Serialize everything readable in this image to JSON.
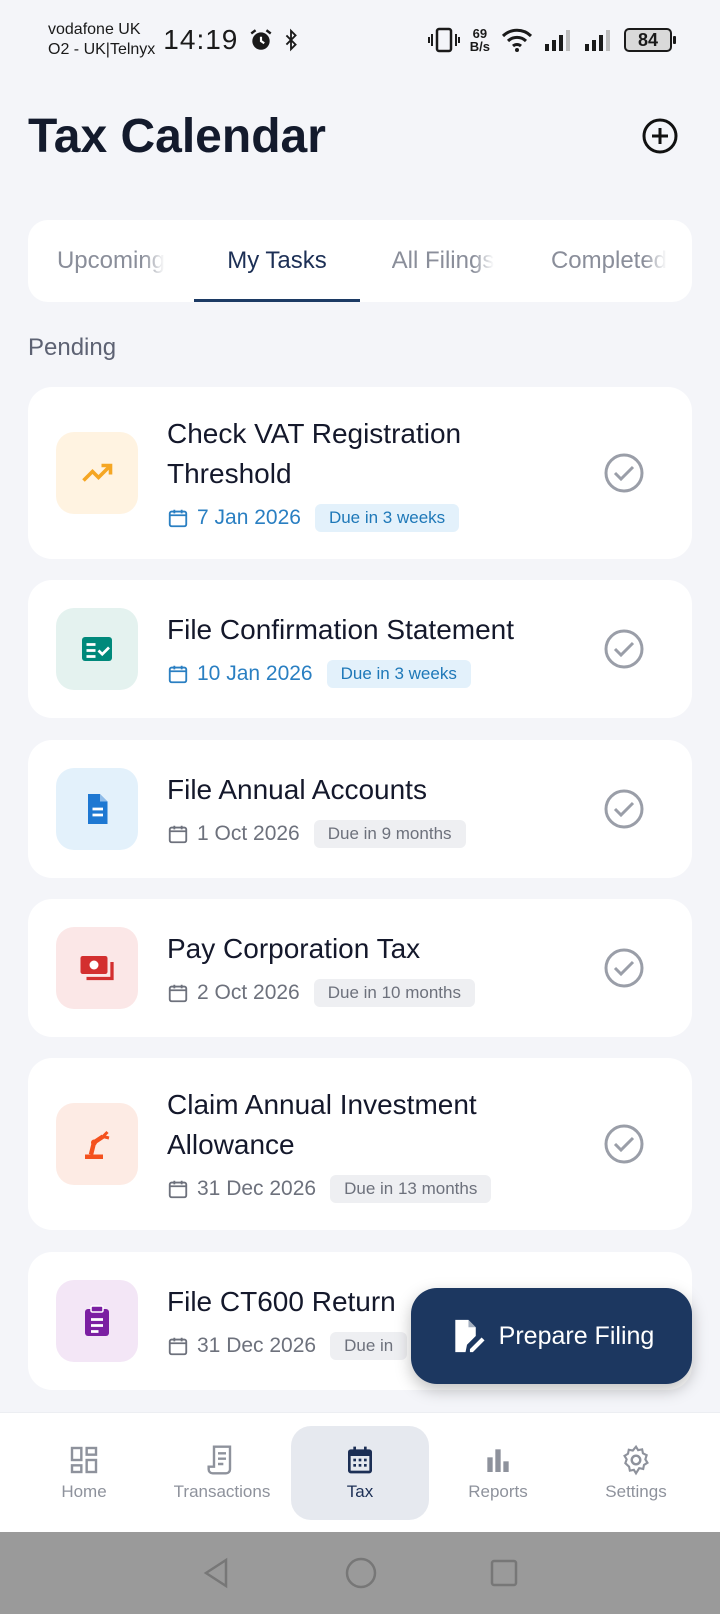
{
  "status_bar": {
    "carrier_1": "vodafone UK",
    "carrier_2": "O2 - UK|Telnyx",
    "time": "14:19",
    "net_speed_value": "69",
    "net_speed_unit": "B/s",
    "battery": "84"
  },
  "header": {
    "title": "Tax Calendar"
  },
  "tabs": [
    {
      "label": "Upcoming",
      "active": false
    },
    {
      "label": "My Tasks",
      "active": true
    },
    {
      "label": "All Filings",
      "active": false
    },
    {
      "label": "Completed",
      "active": false
    }
  ],
  "section_label": "Pending",
  "tasks": [
    {
      "title": "Check VAT Registration Threshold",
      "date": "7 Jan 2026",
      "due": "Due in 3 weeks",
      "icon": "trending-up-icon",
      "accent": "#f5a623",
      "tint": "#fff3e1",
      "urgent": true
    },
    {
      "title": "File Confirmation Statement",
      "date": "10 Jan 2026",
      "due": "Due in 3 weeks",
      "icon": "fact-check-icon",
      "accent": "#00897b",
      "tint": "#e4f2ef",
      "urgent": true
    },
    {
      "title": "File Annual Accounts",
      "date": "1 Oct 2026",
      "due": "Due in 9 months",
      "icon": "document-icon",
      "accent": "#1e78d2",
      "tint": "#e3f1fb",
      "urgent": false
    },
    {
      "title": "Pay Corporation Tax",
      "date": "2 Oct 2026",
      "due": "Due in 10 months",
      "icon": "payments-icon",
      "accent": "#d32f2f",
      "tint": "#fbe7e7",
      "urgent": false
    },
    {
      "title": "Claim Annual Investment Allowance",
      "date": "31 Dec 2026",
      "due": "Due in 13 months",
      "icon": "robot-arm-icon",
      "accent": "#f4511e",
      "tint": "#fdebe4",
      "urgent": false
    },
    {
      "title": "File CT600 Return",
      "date": "31 Dec 2026",
      "due": "Due in",
      "icon": "clipboard-icon",
      "accent": "#7b1fa2",
      "tint": "#f3e6f6",
      "urgent": false
    }
  ],
  "fab": {
    "label": "Prepare Filing"
  },
  "bottom_nav": [
    {
      "label": "Home",
      "icon": "dashboard-icon",
      "active": false
    },
    {
      "label": "Transactions",
      "icon": "receipt-icon",
      "active": false
    },
    {
      "label": "Tax",
      "icon": "calendar-icon",
      "active": true
    },
    {
      "label": "Reports",
      "icon": "bar-chart-icon",
      "active": false
    },
    {
      "label": "Settings",
      "icon": "gear-icon",
      "active": false
    }
  ]
}
